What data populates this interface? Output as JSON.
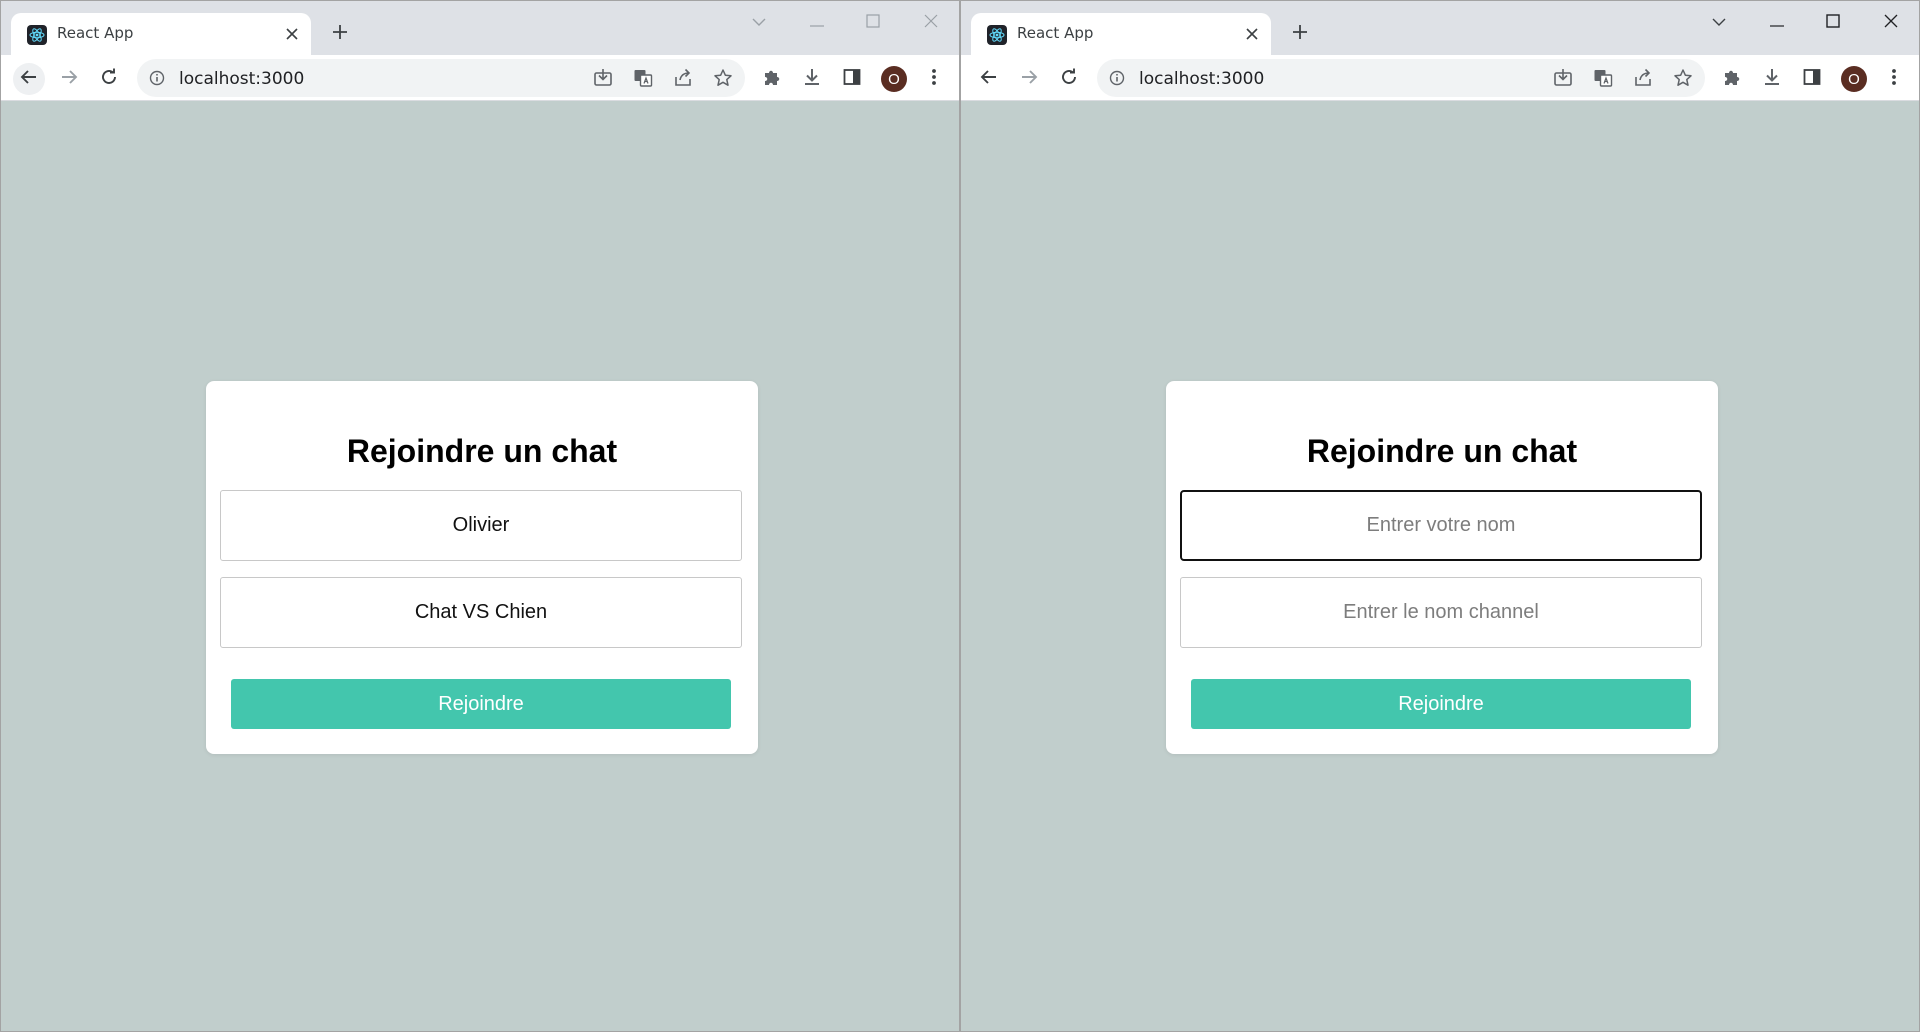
{
  "windows": [
    {
      "tab": {
        "title": "React App",
        "close": "✕"
      },
      "new_tab": "+",
      "address": {
        "url": "localhost:3000"
      },
      "profile_initial": "O",
      "form": {
        "title": "Rejoindre un chat",
        "name_value": "Olivier",
        "name_placeholder": "Entrer votre nom",
        "channel_value": "Chat VS Chien",
        "channel_placeholder": "Entrer le nom channel",
        "join_label": "Rejoindre"
      }
    },
    {
      "tab": {
        "title": "React App",
        "close": "✕"
      },
      "new_tab": "+",
      "address": {
        "url": "localhost:3000"
      },
      "profile_initial": "O",
      "form": {
        "title": "Rejoindre un chat",
        "name_value": "",
        "name_placeholder": "Entrer votre nom",
        "channel_value": "",
        "channel_placeholder": "Entrer le nom channel",
        "join_label": "Rejoindre"
      }
    }
  ],
  "colors": {
    "page_background": "#c1cecc",
    "button_accent": "#43c6ad",
    "tabstrip": "#dee1e6",
    "avatar": "#5a2d22"
  },
  "icons": [
    "react-favicon-icon",
    "close-icon",
    "plus-icon",
    "chevron-down-icon",
    "minimize-icon",
    "maximize-icon",
    "back-arrow-icon",
    "forward-arrow-icon",
    "reload-icon",
    "info-icon",
    "install-app-icon",
    "translate-icon",
    "share-icon",
    "star-icon",
    "puzzle-icon",
    "download-icon",
    "side-panel-icon",
    "kebab-menu-icon"
  ]
}
